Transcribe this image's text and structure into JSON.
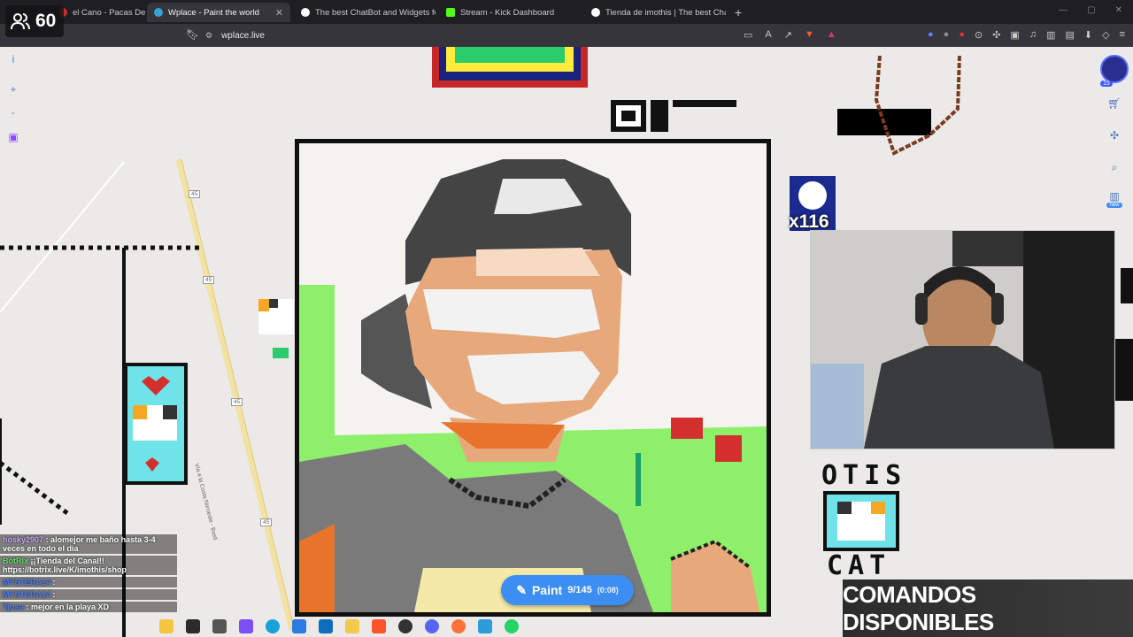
{
  "tabs": [
    {
      "label": "el Cano - Pacas De Bill",
      "active": false,
      "color": "#c9302c"
    },
    {
      "label": "Wplace - Paint the world",
      "active": true,
      "color": "#3aa0d8"
    },
    {
      "label": "The best ChatBot and Widgets for K",
      "active": false,
      "color": "#ffffff"
    },
    {
      "label": "Stream - Kick Dashboard",
      "active": false,
      "color": "#53fc18"
    },
    {
      "label": "Tienda de imothis | The best ChatBo",
      "active": false,
      "color": "#ffffff"
    }
  ],
  "address": {
    "url": "wplace.live"
  },
  "viewers": {
    "count": "60"
  },
  "map": {
    "road_label": "45",
    "road_name": "Vía a la Costa Noroeste - Basti"
  },
  "overlay": {
    "multiplier": "x116",
    "otis": "OTIS",
    "cat": "CAT",
    "comandos": "COMANDOS DISPONIBLES",
    "badge_count": "15",
    "new_label": "new"
  },
  "paint": {
    "label": "Paint",
    "count": "9/145",
    "timer": "(0:08)"
  },
  "chat": [
    {
      "user": "hosky2907",
      "text": ": alomejor me baño hasta 3-4 veces en todo el dia",
      "color": "#c9a7ff"
    },
    {
      "user": "BotRix",
      "text": "¡¡Tienda del Canal!! https://botrix.live/K/imothis/shop",
      "color": "#67e06f"
    },
    {
      "user": "MYSTERA14",
      "text": ":",
      "color": "#4c7bff"
    },
    {
      "user": "MYSTERA14",
      "text": ":",
      "color": "#4c7bff"
    },
    {
      "user": "Tjosu",
      "text": ": mejor en la playa XD",
      "color": "#4c7bff"
    }
  ],
  "colors": {
    "accent": "#3d8ef2",
    "tabbar": "#1f1f23",
    "map": "#ebeae8"
  }
}
